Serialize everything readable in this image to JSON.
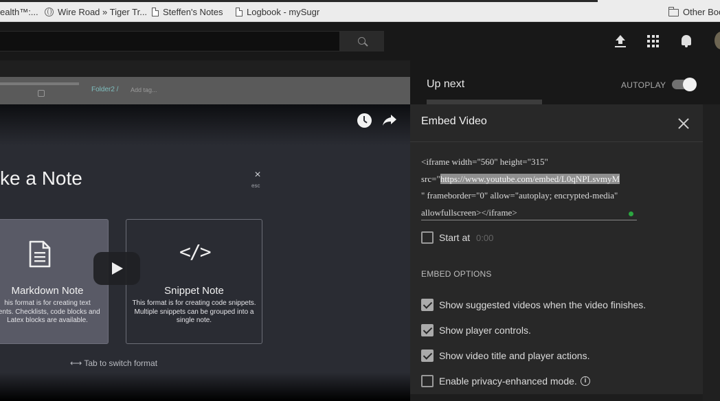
{
  "bookmarks": {
    "items": [
      {
        "label": "ealth™:...",
        "icon": "none"
      },
      {
        "label": "Wire Road » Tiger Tr...",
        "icon": "globe-icon"
      },
      {
        "label": "Steffen's Notes",
        "icon": "page-icon"
      },
      {
        "label": "Logbook - mySugr",
        "icon": "page-icon"
      }
    ],
    "other": "Other Boo"
  },
  "header": {
    "search_icon": "search-icon",
    "upload_icon": "upload-icon",
    "apps_icon": "apps-grid-icon",
    "notifications_icon": "bell-icon"
  },
  "video": {
    "folder_tag": "Folder2 /",
    "add_tag": "Add tag...",
    "note_title": "ke a Note",
    "close_glyph": "×",
    "esc_label": "esc",
    "markdown_card": {
      "title": "Markdown Note",
      "desc_lines": [
        "his format is for creating text",
        "nents. Checklists, code blocks and",
        "Latex blocks are available."
      ]
    },
    "snippet_card": {
      "title": "Snippet Note",
      "code_glyph": "</>",
      "desc_lines": [
        "This format is for creating code snippets.",
        "Multiple snippets can be grouped into a",
        "single note."
      ]
    },
    "tab_switch": "⟷ Tab to switch format"
  },
  "upnext": {
    "title": "Up next",
    "autoplay_label": "AUTOPLAY",
    "autoplay_on": true
  },
  "embed": {
    "title": "Embed Video",
    "code_line1": "<iframe width=\"560\" height=\"315\"",
    "code_src_prefix": "src=\"",
    "code_src_url": "https://www.youtube.com/embed/L0qNPLsvmyM",
    "code_line3": "\" frameborder=\"0\" allow=\"autoplay; encrypted-media\"",
    "code_line4": "allowfullscreen></iframe>",
    "start_at_label": "Start at",
    "start_at_value": "0:00",
    "options_heading": "EMBED OPTIONS",
    "options": [
      {
        "label": "Show suggested videos when the video finishes.",
        "checked": true
      },
      {
        "label": "Show player controls.",
        "checked": true
      },
      {
        "label": "Show video title and player actions.",
        "checked": true
      },
      {
        "label": "Enable privacy-enhanced mode.",
        "checked": false
      }
    ],
    "info_glyph": "i"
  }
}
